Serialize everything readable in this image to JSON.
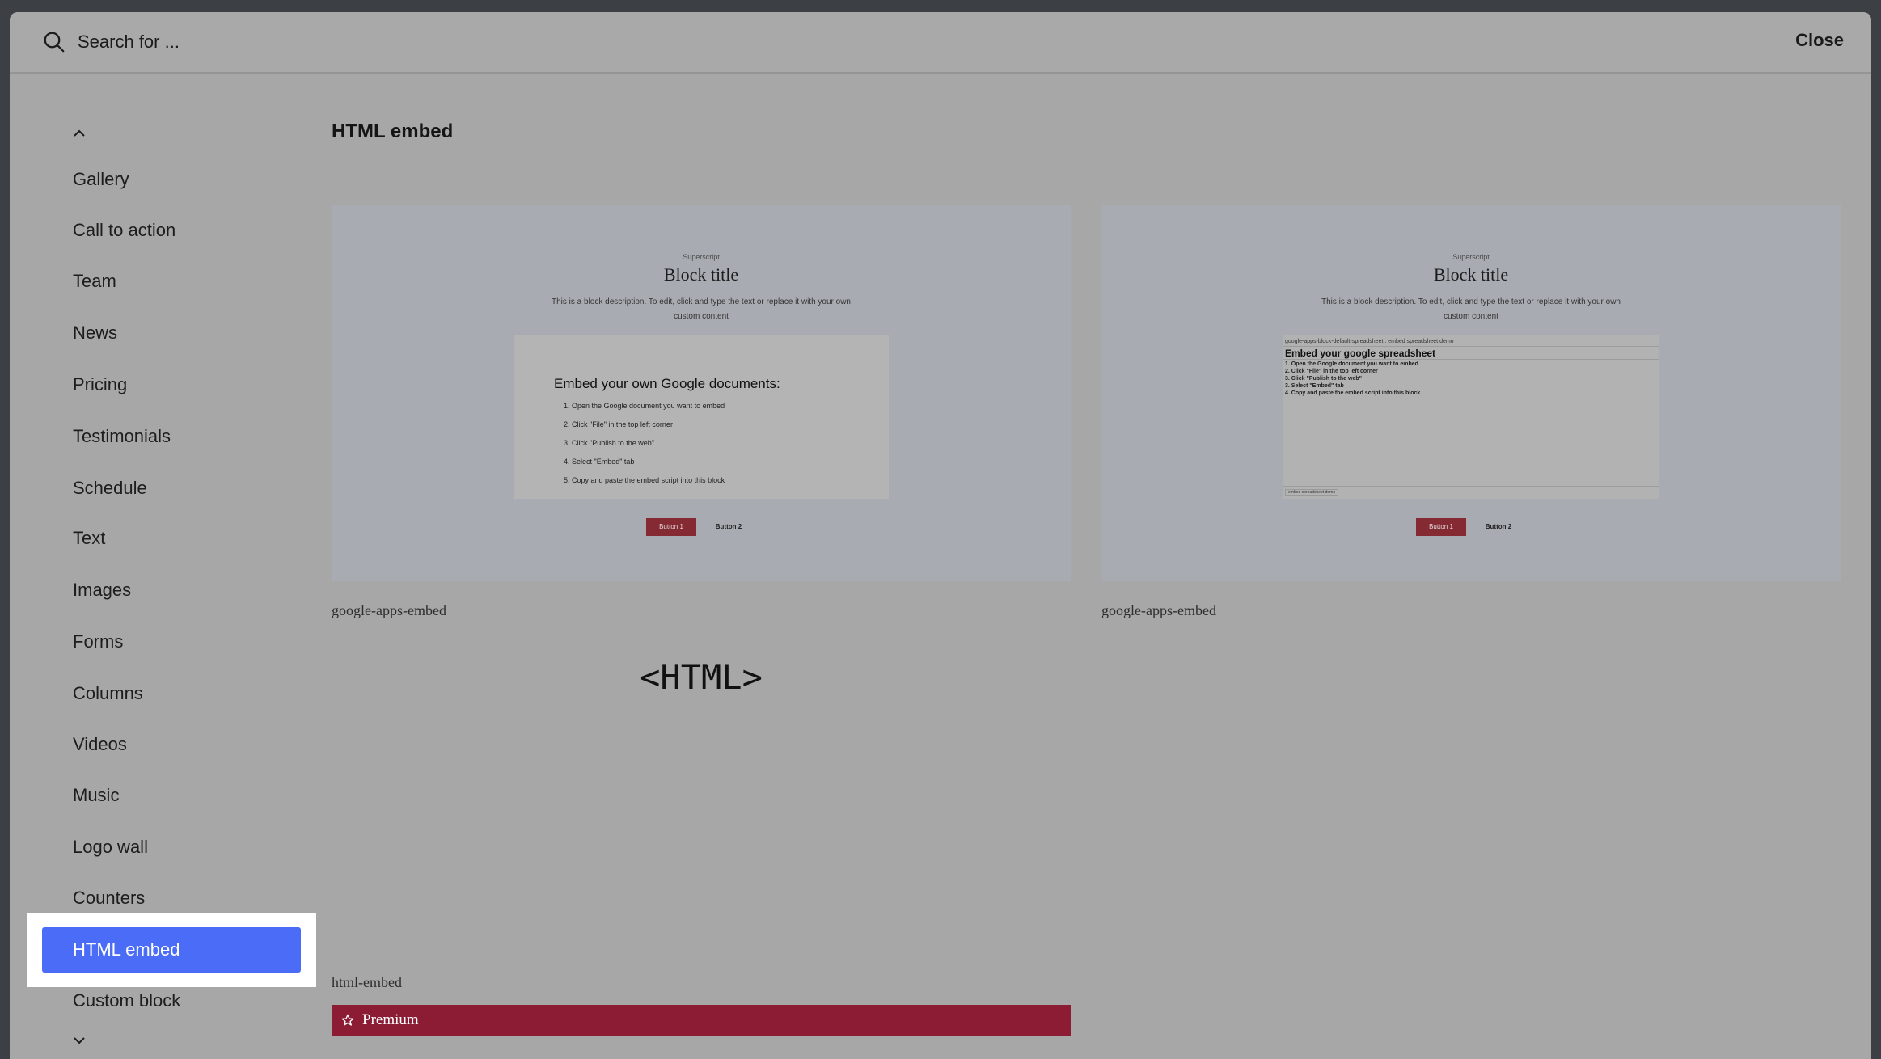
{
  "search": {
    "placeholder": "Search for ...",
    "close_label": "Close"
  },
  "sidebar": {
    "items": [
      "Gallery",
      "Call to action",
      "Team",
      "News",
      "Pricing",
      "Testimonials",
      "Schedule",
      "Text",
      "Images",
      "Forms",
      "Columns",
      "Videos",
      "Music",
      "Logo wall",
      "Counters",
      "HTML embed",
      "Custom block"
    ],
    "active": "HTML embed"
  },
  "main": {
    "title": "HTML embed",
    "cards": [
      {
        "name": "google-apps-embed",
        "preview": {
          "superscript": "Superscript",
          "title": "Block title",
          "description": "This is a block description. To edit, click and type the text or replace it with your own custom content",
          "embed_heading": "Embed your own Google documents:",
          "steps": [
            "Open the Google document you want to embed",
            "Click \"File\" in the top left corner",
            "Click \"Publish to the web\"",
            "Select \"Embed\" tab",
            "Copy and paste the embed script into this block"
          ],
          "button1": "Button 1",
          "button2": "Button 2"
        }
      },
      {
        "name": "google-apps-embed",
        "preview": {
          "superscript": "Superscript",
          "title": "Block title",
          "description": "This is a block description. To edit, click and type the text or replace it with your own custom content",
          "sheet_topline": "google-apps-block-default-spreadsheet : embed spreadsheet demo",
          "embed_heading": "Embed your google spreadsheet",
          "steps": [
            "1. Open the Google document you want to embed",
            "2. Click \"File\" in the top left corner",
            "3. Click \"Publish to the web\"",
            "3. Select \"Embed\" tab",
            "4. Copy and paste the embed script into this block"
          ],
          "sheet_tab": "embed spreadsheet demo",
          "button1": "Button 1",
          "button2": "Button 2"
        }
      },
      {
        "name": "html-embed",
        "logo_text": "<HTML>",
        "badge": "Premium"
      }
    ]
  }
}
